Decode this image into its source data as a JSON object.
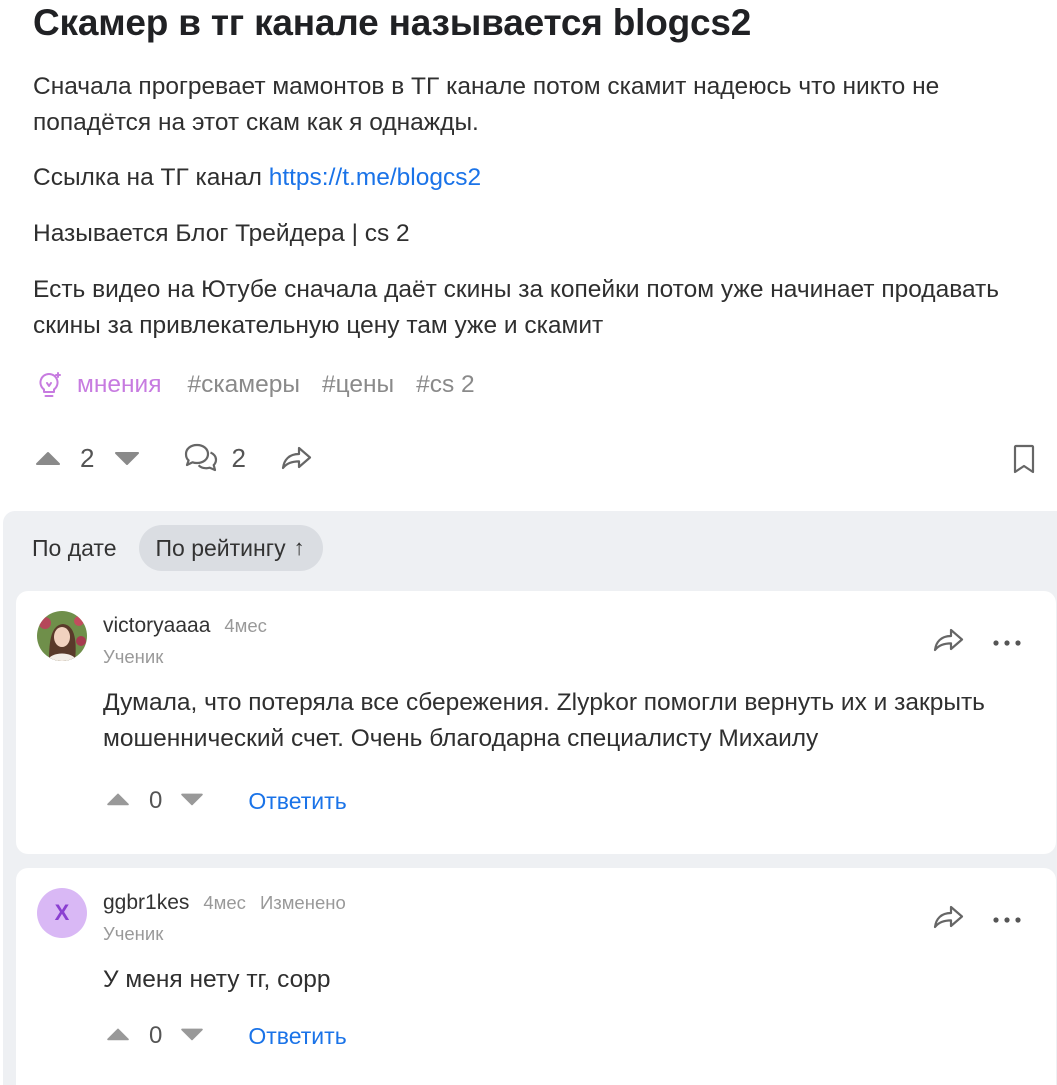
{
  "post": {
    "title": "Скамер в тг канале называется blogcs2",
    "p1": "Сначала прогревает мамонтов в ТГ канале потом скамит надеюсь что никто не попадётся на этот скам как я однажды.",
    "p2_prefix": "Ссылка на ТГ канал ",
    "p2_link": "https://t.me/blogcs2",
    "p3": "Называется Блог Трейдера | cs 2",
    "p4": "Есть видео на Ютубе сначала даёт скины за копейки потом уже начинает продавать скины за привлекательную цену там уже и скамит",
    "topic": "мнения",
    "tags": [
      "#скамеры",
      "#цены",
      "#cs 2"
    ],
    "votes": "2",
    "comments_count": "2"
  },
  "sort": {
    "by_date": "По дате",
    "by_rating": "По рейтингу",
    "arrow": "↑"
  },
  "comments": [
    {
      "author": "victoryaaaa",
      "time": "4мес",
      "edited": "",
      "rank": "Ученик",
      "text": "Думала, что потеряла все сбережения. Zlypkor помогли вернуть их и закрыть мошеннический счет. Очень благодарна специалисту Михаилу",
      "votes": "0",
      "reply": "Ответить"
    },
    {
      "author": "ggbr1kes",
      "avatar_letter": "X",
      "time": "4мес",
      "edited": "Изменено",
      "rank": "Ученик",
      "text": "У меня нету тг, сорр",
      "votes": "0",
      "reply": "Ответить"
    }
  ],
  "colors": {
    "link": "#1a73e8",
    "topic": "#c77be0",
    "comments_bg": "#eef0f3"
  }
}
